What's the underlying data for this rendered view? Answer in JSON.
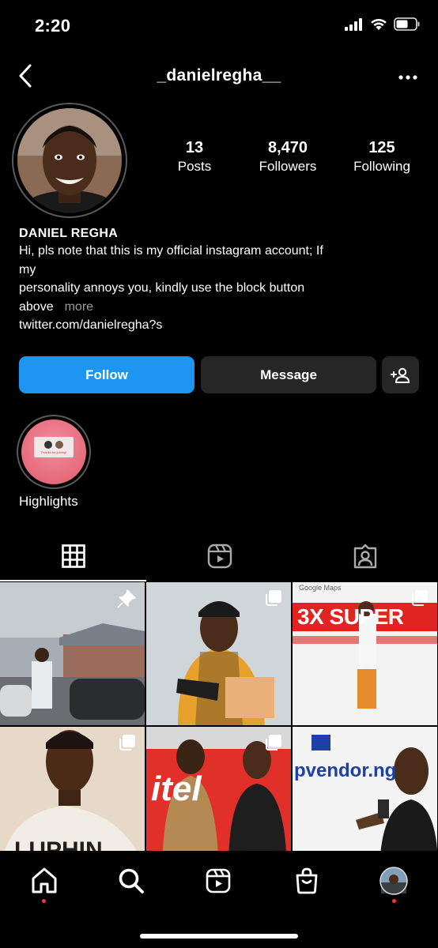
{
  "status_bar": {
    "time": "2:20"
  },
  "header": {
    "username": "_danielregha__"
  },
  "profile": {
    "stats": [
      {
        "value": "13",
        "label": "Posts"
      },
      {
        "value": "8,470",
        "label": "Followers"
      },
      {
        "value": "125",
        "label": "Following"
      }
    ],
    "display_name": "DANIEL REGHA",
    "bio_lines": [
      "Hi, pls note that this is my official instagram account; If",
      "my",
      "personality annoys you, kindly use the block button",
      "above"
    ],
    "more_label": "more",
    "link": "twitter.com/danielregha?s"
  },
  "actions": {
    "follow_label": "Follow",
    "message_label": "Message"
  },
  "highlights": [
    {
      "label": "Highlights",
      "cover_text_1": "Thanks for joining!",
      "cover_text_2": ""
    }
  ],
  "tabs": [
    {
      "name": "posts-grid",
      "active": true
    },
    {
      "name": "reels",
      "active": false
    },
    {
      "name": "tagged",
      "active": false
    }
  ],
  "posts": [
    {
      "badge": "pinned-icon"
    },
    {
      "badge": "multiple-posts-icon"
    },
    {
      "badge": "multiple-posts-icon",
      "text_1": "3X SUPER",
      "text_2": "Google Maps"
    },
    {
      "badge": "multiple-posts-icon",
      "text_1": "LUPHIN"
    },
    {
      "badge": "multiple-posts-icon",
      "text_1": "itel"
    },
    {
      "badge": "none",
      "text_1": "pvendor.ng"
    }
  ],
  "bottom_nav": [
    "home-icon",
    "search-icon",
    "reels-icon",
    "shop-icon",
    "profile-avatar"
  ],
  "colors": {
    "accent": "#1c96f0",
    "button_dark": "#262626",
    "notification_dot": "#ff3040"
  }
}
